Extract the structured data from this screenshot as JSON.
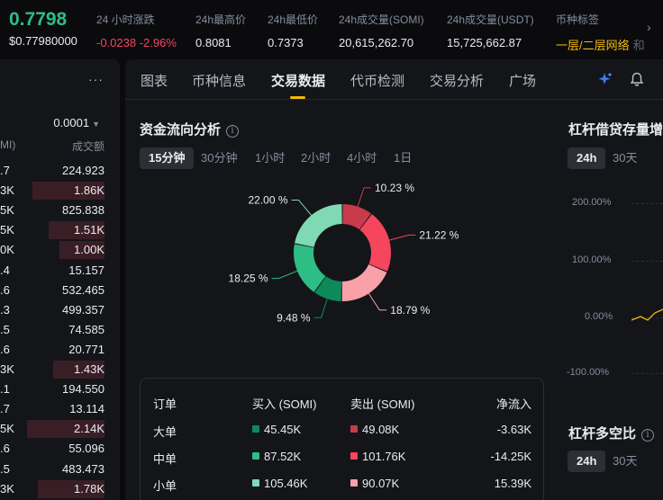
{
  "ticker": {
    "price": "0.7798",
    "price_usd": "$0.77980000",
    "stats": [
      {
        "label": "24 小时涨跌",
        "value": "-0.0238 -2.96%"
      },
      {
        "label": "24h最高价",
        "value": "0.8081"
      },
      {
        "label": "24h最低价",
        "value": "0.7373"
      },
      {
        "label": "24h成交量(SOMI)",
        "value": "20,615,262.70"
      },
      {
        "label": "24h成交量(USDT)",
        "value": "15,725,662.87"
      },
      {
        "label": "币种标签",
        "value": "一层/二层网络"
      }
    ],
    "tag_overflow": "和"
  },
  "orderbook": {
    "more_icon": "more-dots-icon",
    "precision": "0.0001",
    "header_left": "MI)",
    "header_right": "成交额",
    "rows": [
      {
        "left": ".7",
        "right": "224.923",
        "depth": 0
      },
      {
        "left": "3K",
        "right": "1.86K",
        "depth": 0.8
      },
      {
        "left": "5K",
        "right": "825.838",
        "depth": 0
      },
      {
        "left": "5K",
        "right": "1.51K",
        "depth": 0.62
      },
      {
        "left": "0K",
        "right": "1.00K",
        "depth": 0.5
      },
      {
        "left": ".4",
        "right": "15.157",
        "depth": 0
      },
      {
        "left": ".6",
        "right": "532.465",
        "depth": 0
      },
      {
        "left": ".3",
        "right": "499.357",
        "depth": 0
      },
      {
        "left": ".5",
        "right": "74.585",
        "depth": 0
      },
      {
        "left": ".6",
        "right": "20.771",
        "depth": 0
      },
      {
        "left": "3K",
        "right": "1.43K",
        "depth": 0.57
      },
      {
        "left": ".1",
        "right": "194.550",
        "depth": 0
      },
      {
        "left": ".7",
        "right": "13.114",
        "depth": 0
      },
      {
        "left": "5K",
        "right": "2.14K",
        "depth": 0.86
      },
      {
        "left": ".6",
        "right": "55.096",
        "depth": 0
      },
      {
        "left": ".5",
        "right": "483.473",
        "depth": 0
      },
      {
        "left": "3K",
        "right": "1.78K",
        "depth": 0.74
      }
    ]
  },
  "tabs": [
    "图表",
    "币种信息",
    "交易数据",
    "代币检测",
    "交易分析",
    "广场"
  ],
  "active_tab": "交易数据",
  "icons": {
    "ai": "sparkle-icon",
    "bell": "bell-icon"
  },
  "fund_flow": {
    "title": "资金流向分析",
    "intervals": [
      "15分钟",
      "30分钟",
      "1小时",
      "2小时",
      "4小时",
      "1日"
    ],
    "active_interval": "15分钟",
    "chart_data": {
      "type": "pie",
      "slices": [
        {
          "label": "10.23 %",
          "value": 10.23,
          "color": "#c93a4b"
        },
        {
          "label": "21.22 %",
          "value": 21.22,
          "color": "#f6465d"
        },
        {
          "label": "18.79 %",
          "value": 18.79,
          "color": "#f9a1a8"
        },
        {
          "label": "9.48 %",
          "value": 9.48,
          "color": "#0e8a5a"
        },
        {
          "label": "18.25 %",
          "value": 18.25,
          "color": "#2ebd85"
        },
        {
          "label": "22.00 %",
          "value": 22.0,
          "color": "#7fd9b3"
        }
      ]
    },
    "table": {
      "headers": [
        "订单",
        "买入 (SOMI)",
        "卖出 (SOMI)",
        "净流入"
      ],
      "rows": [
        {
          "order": "大单",
          "buy": "45.45K",
          "sell": "49.08K",
          "net": "-3.63K",
          "buy_color": "#0e8a5a",
          "sell_color": "#c93a4b"
        },
        {
          "order": "中单",
          "buy": "87.52K",
          "sell": "101.76K",
          "net": "-14.25K",
          "buy_color": "#2ebd85",
          "sell_color": "#f6465d"
        },
        {
          "order": "小单",
          "buy": "105.46K",
          "sell": "90.07K",
          "net": "15.39K",
          "buy_color": "#7fd9b3",
          "sell_color": "#f9a1a8"
        }
      ]
    }
  },
  "margin_loan": {
    "title": "杠杆借贷存量增",
    "periods": [
      "24h",
      "30天"
    ],
    "active_period": "24h",
    "y_ticks": [
      "200.00%",
      "100.00%",
      "0.00%",
      "-100.00%"
    ]
  },
  "long_short": {
    "title": "杠杆多空比",
    "periods": [
      "24h",
      "30天"
    ],
    "active_period": "24h"
  }
}
